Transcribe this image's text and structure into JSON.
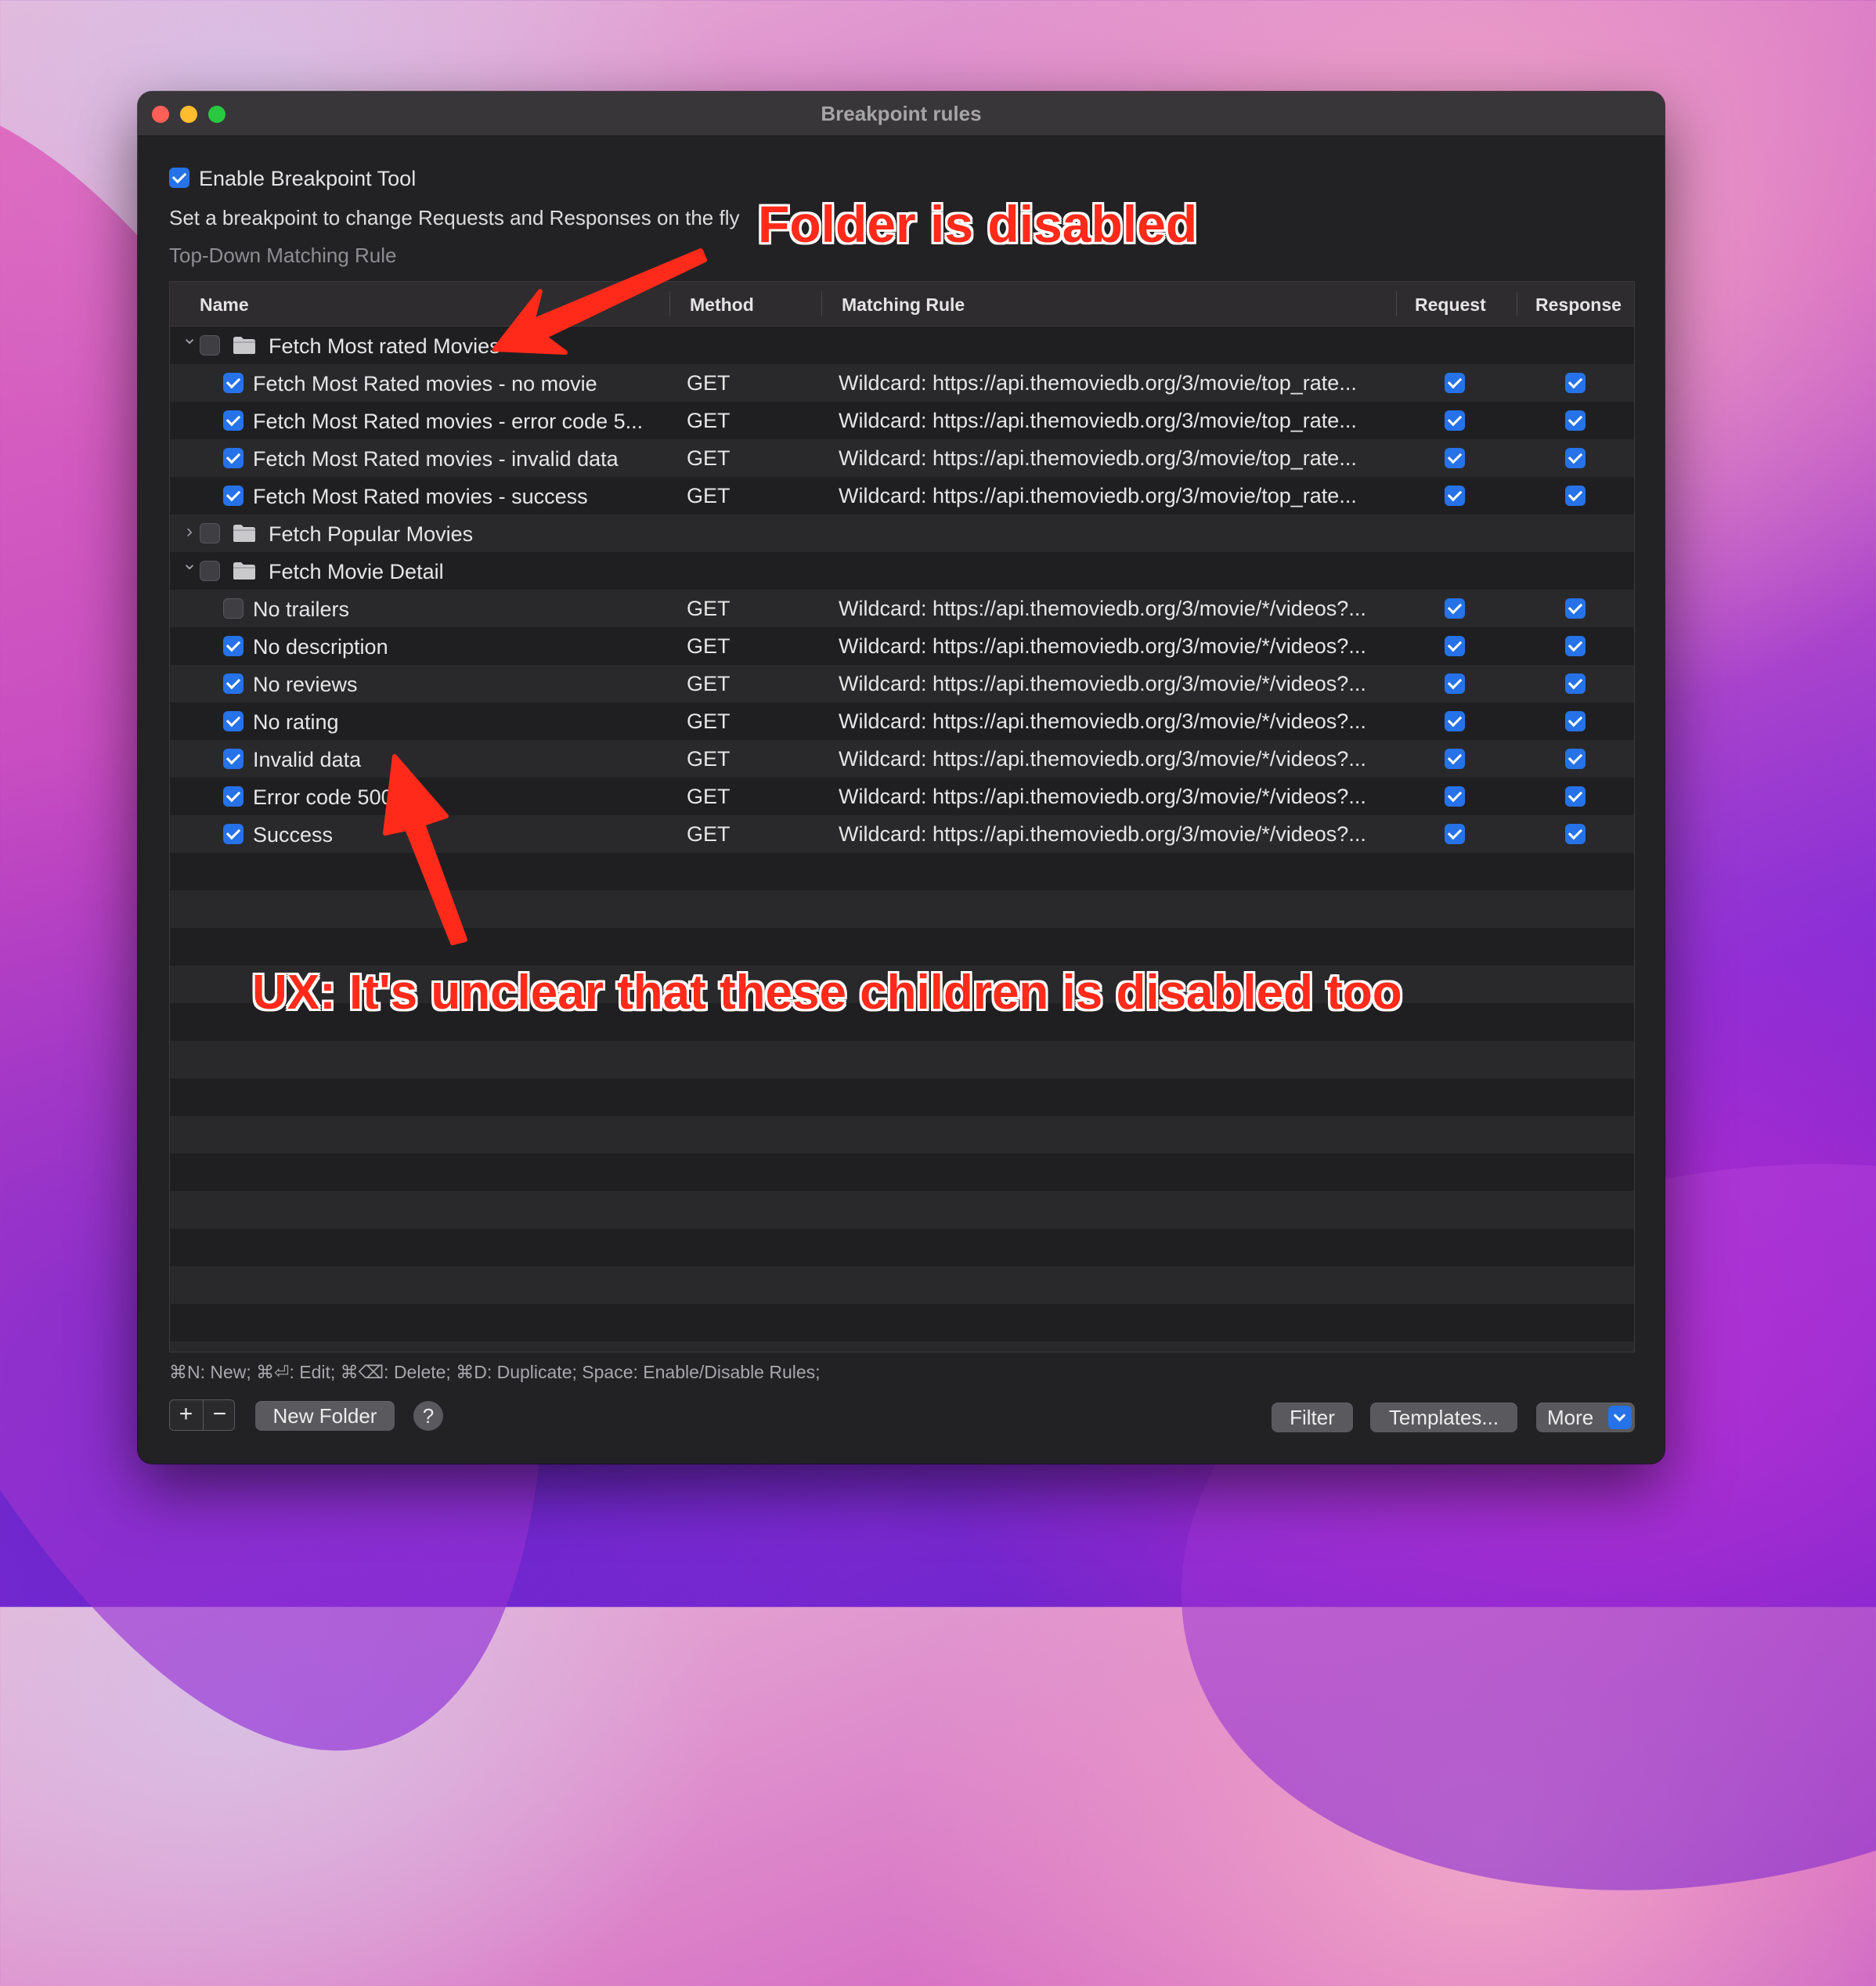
{
  "window": {
    "title": "Breakpoint rules"
  },
  "header": {
    "enable_label": "Enable Breakpoint Tool",
    "enable_checked": true,
    "description": "Set a breakpoint to change Requests and Responses on the fly",
    "subtitle": "Top-Down Matching Rule"
  },
  "table": {
    "columns": [
      "Name",
      "Method",
      "Matching Rule",
      "Request",
      "Response"
    ],
    "folders": [
      {
        "name": "Fetch Most rated Movies",
        "expanded": true,
        "enabled": false,
        "rules": [
          {
            "name": "Fetch Most Rated movies - no movie",
            "method": "GET",
            "rule": "Wildcard: https://api.themoviedb.org/3/movie/top_rate...",
            "enabled": true,
            "request": true,
            "response": true
          },
          {
            "name": "Fetch Most Rated movies - error code 5...",
            "method": "GET",
            "rule": "Wildcard: https://api.themoviedb.org/3/movie/top_rate...",
            "enabled": true,
            "request": true,
            "response": true
          },
          {
            "name": "Fetch Most Rated movies - invalid data",
            "method": "GET",
            "rule": "Wildcard: https://api.themoviedb.org/3/movie/top_rate...",
            "enabled": true,
            "request": true,
            "response": true
          },
          {
            "name": "Fetch Most Rated movies - success",
            "method": "GET",
            "rule": "Wildcard: https://api.themoviedb.org/3/movie/top_rate...",
            "enabled": true,
            "request": true,
            "response": true
          }
        ]
      },
      {
        "name": "Fetch Popular Movies",
        "expanded": false,
        "enabled": false,
        "rules": []
      },
      {
        "name": "Fetch Movie Detail",
        "expanded": true,
        "enabled": false,
        "rules": [
          {
            "name": "No trailers",
            "method": "GET",
            "rule": "Wildcard: https://api.themoviedb.org/3/movie/*/videos?...",
            "enabled": false,
            "request": true,
            "response": true
          },
          {
            "name": "No description",
            "method": "GET",
            "rule": "Wildcard: https://api.themoviedb.org/3/movie/*/videos?...",
            "enabled": true,
            "request": true,
            "response": true
          },
          {
            "name": "No reviews",
            "method": "GET",
            "rule": "Wildcard: https://api.themoviedb.org/3/movie/*/videos?...",
            "enabled": true,
            "request": true,
            "response": true
          },
          {
            "name": "No rating",
            "method": "GET",
            "rule": "Wildcard: https://api.themoviedb.org/3/movie/*/videos?...",
            "enabled": true,
            "request": true,
            "response": true
          },
          {
            "name": "Invalid data",
            "method": "GET",
            "rule": "Wildcard: https://api.themoviedb.org/3/movie/*/videos?...",
            "enabled": true,
            "request": true,
            "response": true
          },
          {
            "name": "Error code 500",
            "method": "GET",
            "rule": "Wildcard: https://api.themoviedb.org/3/movie/*/videos?...",
            "enabled": true,
            "request": true,
            "response": true
          },
          {
            "name": "Success",
            "method": "GET",
            "rule": "Wildcard: https://api.themoviedb.org/3/movie/*/videos?...",
            "enabled": true,
            "request": true,
            "response": true
          }
        ]
      }
    ]
  },
  "footer": {
    "shortcuts": "⌘N: New; ⌘⏎: Edit; ⌘⌫: Delete; ⌘D: Duplicate; Space: Enable/Disable Rules;",
    "add_label": "+",
    "remove_label": "−",
    "new_folder_label": "New Folder",
    "help_label": "?",
    "filter_label": "Filter",
    "templates_label": "Templates...",
    "more_label": "More"
  },
  "annotations": {
    "folder_disabled": "Folder is disabled",
    "children_unclear": "UX: It's unclear that these children is disabled too"
  },
  "colors": {
    "accent": "#2672e8",
    "annotation": "#ff2a1a",
    "window_bg": "#222224"
  },
  "icons": [
    "chevron-down-icon",
    "chevron-right-icon",
    "folder-icon",
    "checkbox-icon",
    "dropdown-arrow-icon"
  ]
}
